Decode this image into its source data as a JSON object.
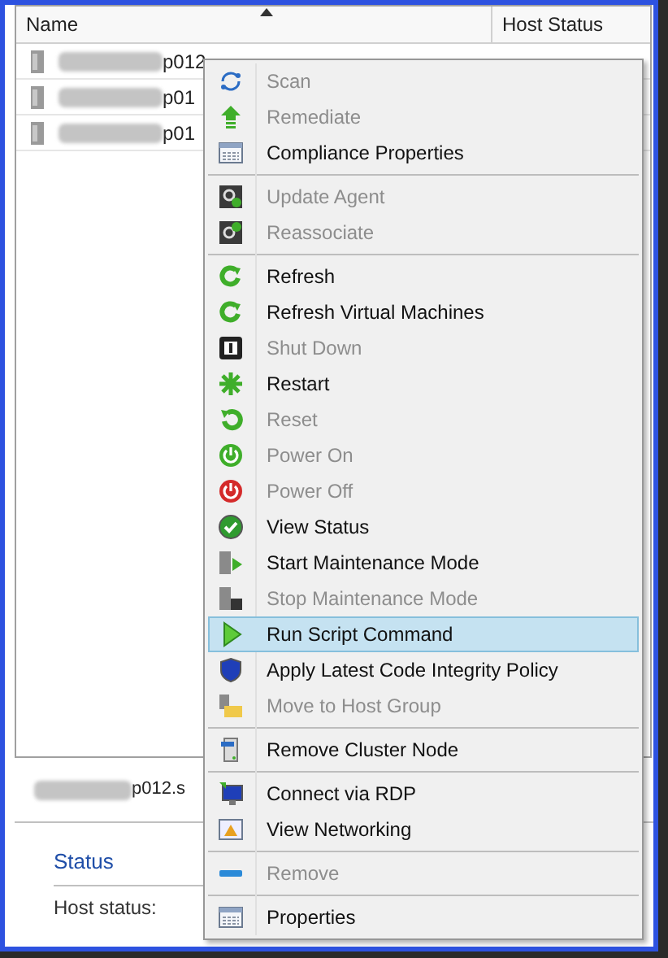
{
  "table": {
    "columns": [
      "Name",
      "Host Status"
    ],
    "rows": [
      {
        "name": "p012"
      },
      {
        "name": "p01"
      },
      {
        "name": "p01"
      }
    ]
  },
  "details": {
    "title": "p012.s",
    "section": "Status",
    "fields": [
      {
        "label": "Host status:"
      }
    ]
  },
  "context_menu": {
    "groups": [
      {
        "items": [
          {
            "label": "Scan",
            "disabled": true,
            "selected": false
          },
          {
            "label": "Remediate",
            "disabled": true,
            "selected": false
          },
          {
            "label": "Compliance Properties",
            "disabled": false,
            "selected": false
          }
        ]
      },
      {
        "items": [
          {
            "label": "Update Agent",
            "disabled": true,
            "selected": false
          },
          {
            "label": "Reassociate",
            "disabled": true,
            "selected": false
          }
        ]
      },
      {
        "items": [
          {
            "label": "Refresh",
            "disabled": false,
            "selected": false
          },
          {
            "label": "Refresh Virtual Machines",
            "disabled": false,
            "selected": false
          },
          {
            "label": "Shut Down",
            "disabled": true,
            "selected": false
          },
          {
            "label": "Restart",
            "disabled": false,
            "selected": false
          },
          {
            "label": "Reset",
            "disabled": true,
            "selected": false
          },
          {
            "label": "Power On",
            "disabled": true,
            "selected": false
          },
          {
            "label": "Power Off",
            "disabled": true,
            "selected": false
          },
          {
            "label": "View Status",
            "disabled": false,
            "selected": false
          },
          {
            "label": "Start Maintenance Mode",
            "disabled": false,
            "selected": false
          },
          {
            "label": "Stop Maintenance Mode",
            "disabled": true,
            "selected": false
          },
          {
            "label": "Run Script Command",
            "disabled": false,
            "selected": true
          },
          {
            "label": "Apply Latest Code Integrity Policy",
            "disabled": false,
            "selected": false
          },
          {
            "label": "Move to Host Group",
            "disabled": true,
            "selected": false
          }
        ]
      },
      {
        "items": [
          {
            "label": "Remove Cluster Node",
            "disabled": false,
            "selected": false
          }
        ]
      },
      {
        "items": [
          {
            "label": "Connect via RDP",
            "disabled": false,
            "selected": false
          },
          {
            "label": "View Networking",
            "disabled": false,
            "selected": false
          }
        ]
      },
      {
        "items": [
          {
            "label": "Remove",
            "disabled": true,
            "selected": false
          }
        ]
      },
      {
        "items": [
          {
            "label": "Properties",
            "disabled": false,
            "selected": false
          }
        ]
      }
    ]
  }
}
